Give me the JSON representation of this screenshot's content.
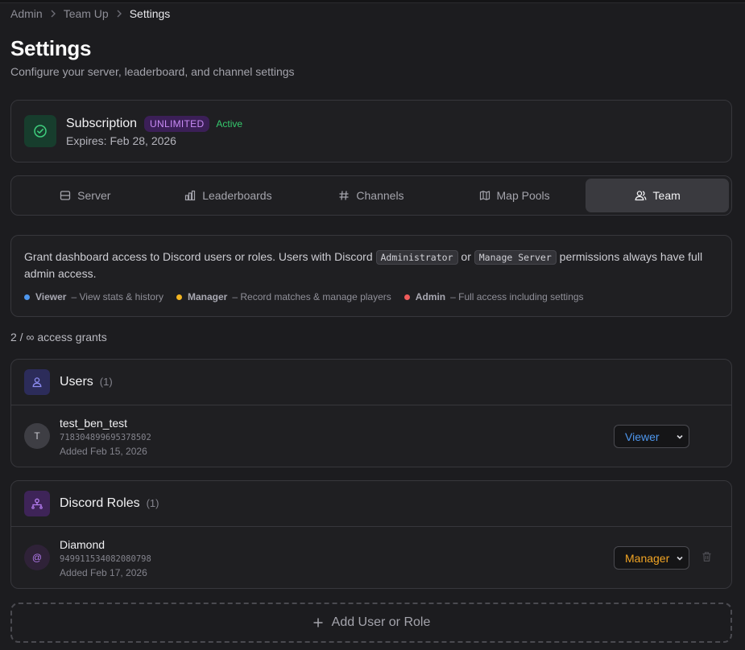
{
  "breadcrumb": {
    "items": [
      "Admin",
      "Team Up"
    ],
    "current": "Settings"
  },
  "header": {
    "title": "Settings",
    "subtitle": "Configure your server, leaderboard, and channel settings"
  },
  "subscription": {
    "title": "Subscription",
    "plan": "UNLIMITED",
    "status": "Active",
    "expires": "Expires: Feb 28, 2026",
    "icon": "check-circle-icon"
  },
  "tabs": [
    {
      "label": "Server",
      "icon": "server-icon"
    },
    {
      "label": "Leaderboards",
      "icon": "bar-chart-icon"
    },
    {
      "label": "Channels",
      "icon": "hash-icon"
    },
    {
      "label": "Map Pools",
      "icon": "map-icon"
    },
    {
      "label": "Team",
      "icon": "users-icon",
      "active": true
    }
  ],
  "info": {
    "text_before": "Grant dashboard access to Discord users or roles. Users with Discord ",
    "perm1": "Administrator",
    "text_mid": " or ",
    "perm2": "Manage Server",
    "text_after": " permissions always have full admin access.",
    "legend": [
      {
        "name": "Viewer",
        "desc": "– View stats & history",
        "color": "#4e97ee"
      },
      {
        "name": "Manager",
        "desc": "– Record matches & manage players",
        "color": "#f2b421"
      },
      {
        "name": "Admin",
        "desc": "– Full access including settings",
        "color": "#ef5b5b"
      }
    ]
  },
  "grants": {
    "count_text": "2 / ∞ access grants"
  },
  "users_section": {
    "title": "Users",
    "count": "(1)",
    "rows": [
      {
        "avatar": "T",
        "name": "test_ben_test",
        "id": "718304899695378502",
        "added": "Added Feb 15, 2026",
        "role": "Viewer",
        "role_color": "#4e97ee"
      }
    ]
  },
  "roles_section": {
    "title": "Discord Roles",
    "count": "(1)",
    "rows": [
      {
        "avatar": "@",
        "name": "Diamond",
        "id": "949911534082080798",
        "added": "Added Feb 17, 2026",
        "role": "Manager",
        "role_color": "#f2a524"
      }
    ]
  },
  "add_button": {
    "label": "Add User or Role"
  },
  "colors": {
    "accent_green": "#35c96d",
    "accent_purple": "#c98bf6",
    "viewer": "#4e97ee",
    "manager": "#f2a524"
  }
}
